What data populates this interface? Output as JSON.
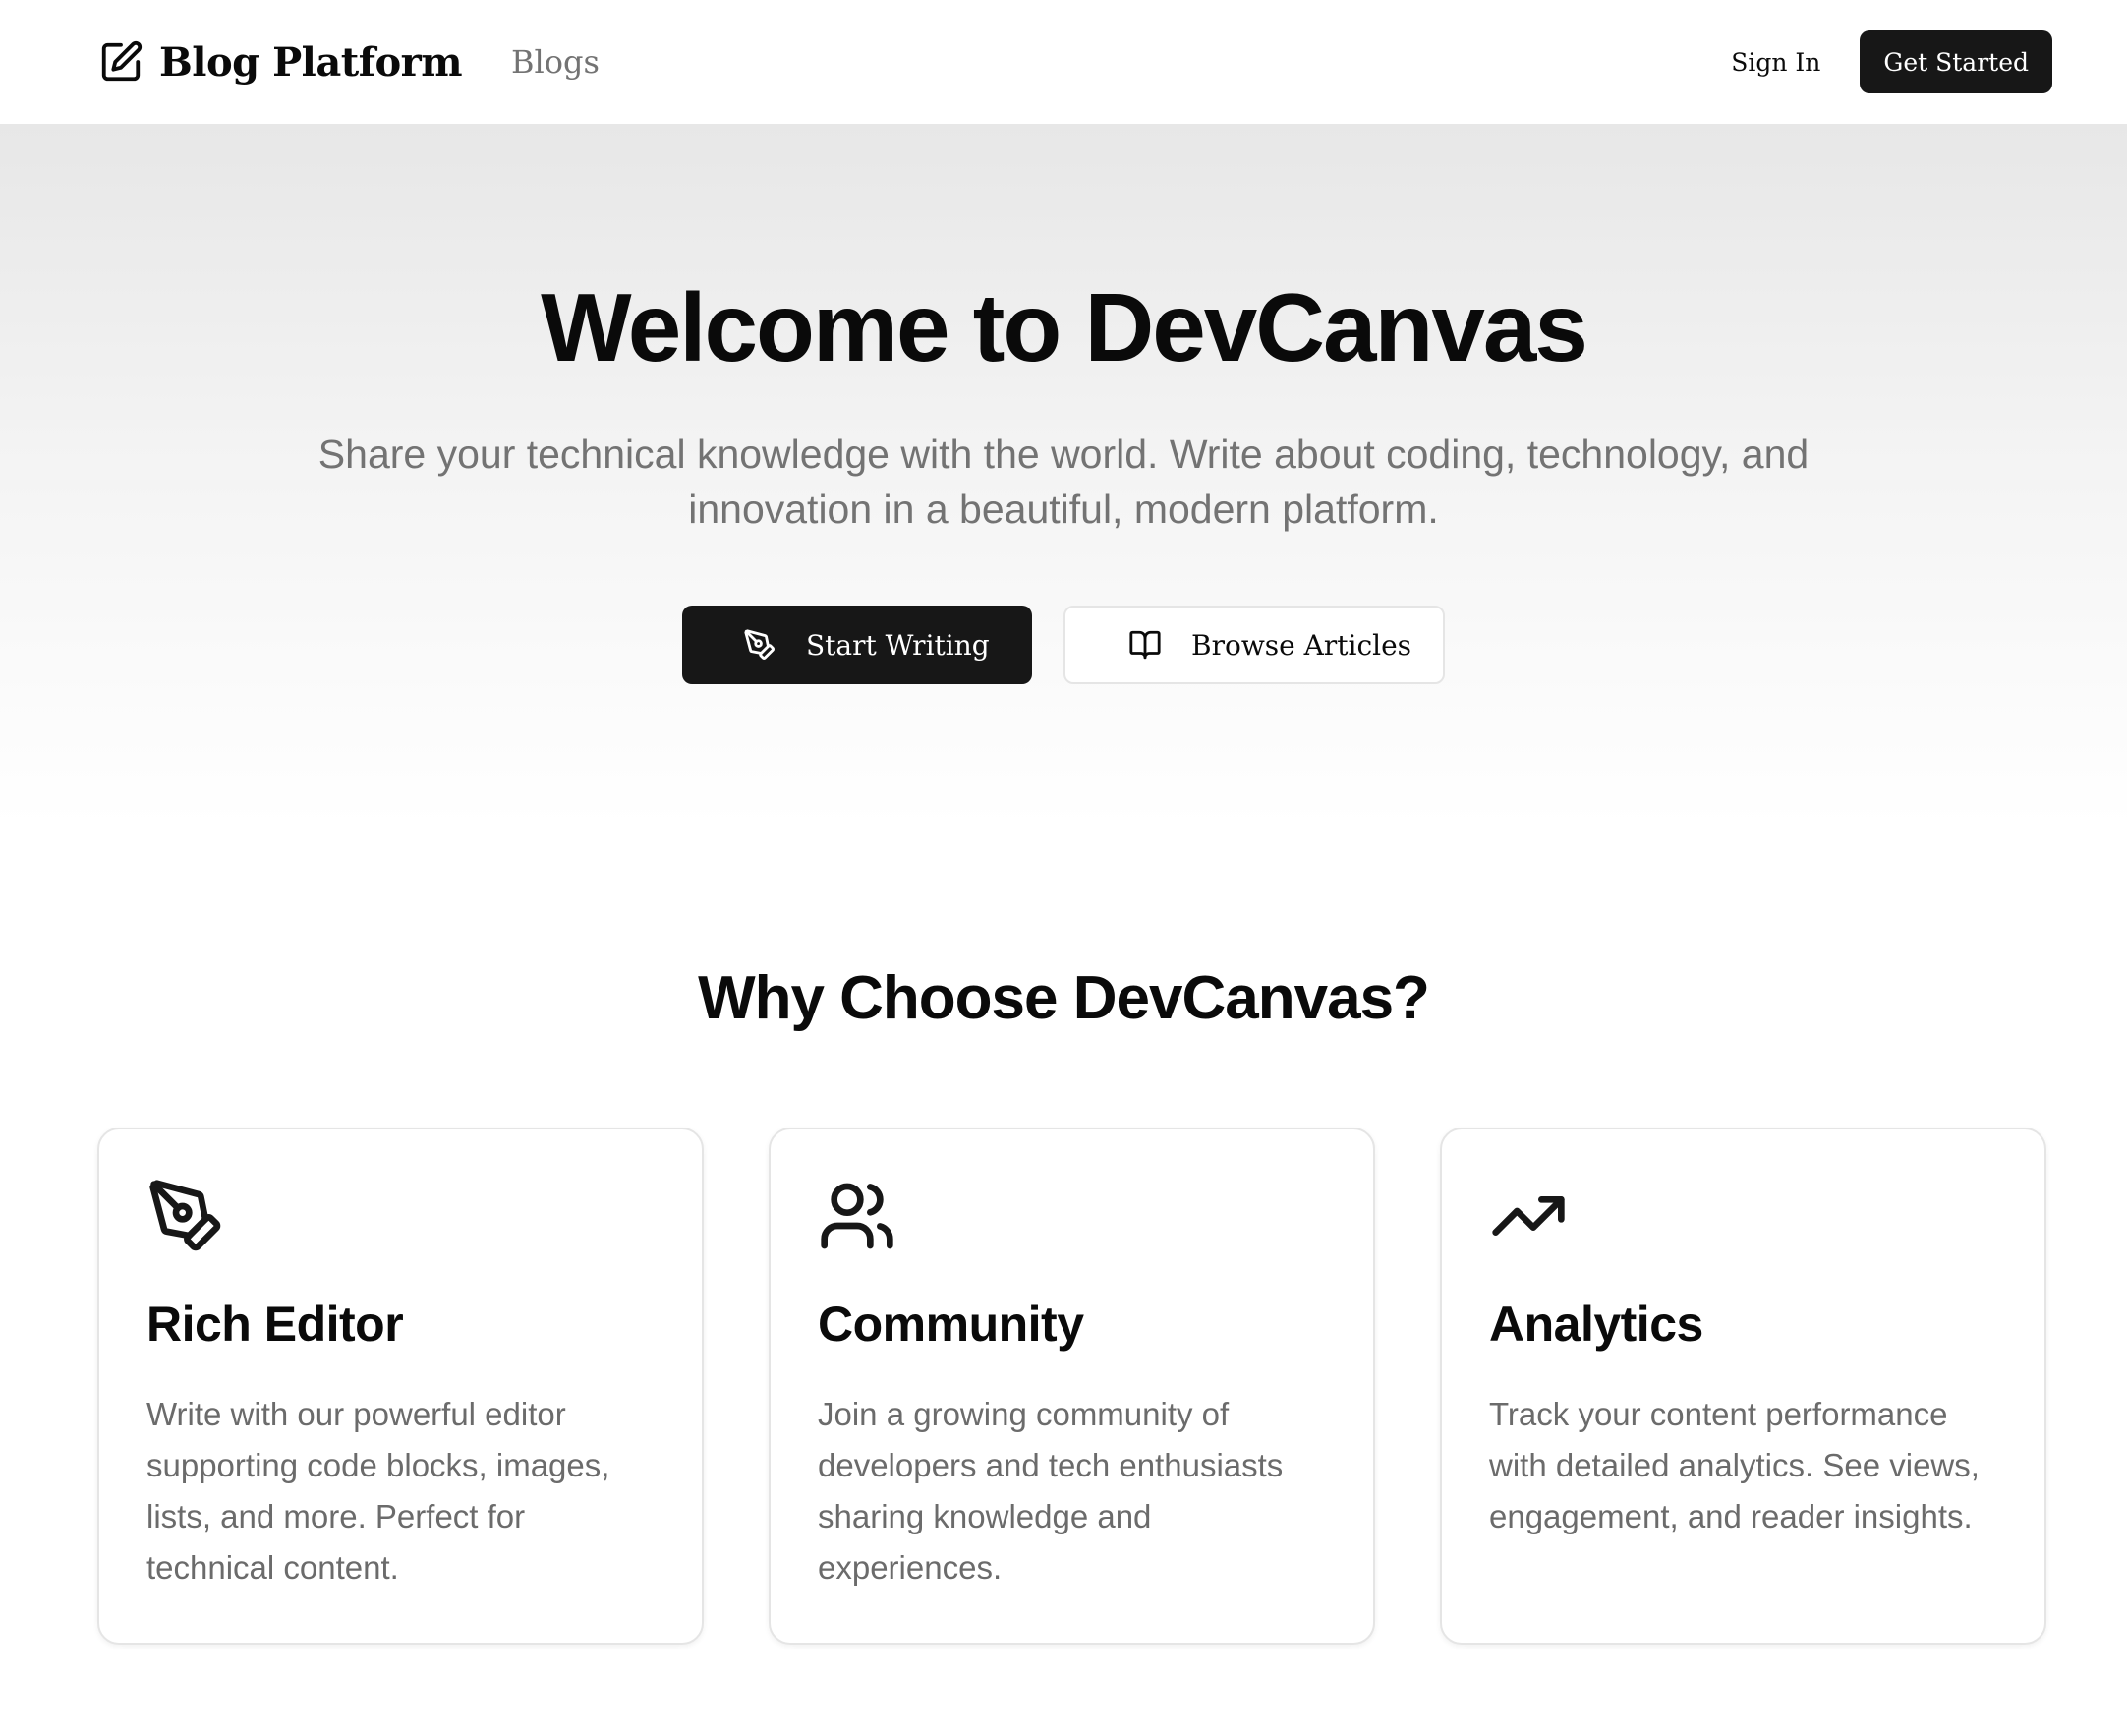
{
  "header": {
    "brand_name": "Blog Platform",
    "brand_icon": "edit-square-icon",
    "nav": {
      "blogs": "Blogs"
    },
    "sign_in": "Sign In",
    "get_started": "Get Started"
  },
  "hero": {
    "title": "Welcome to DevCanvas",
    "subtitle": "Share your technical knowledge with the world. Write about coding, technology, and innovation in a beautiful, modern platform.",
    "primary_button": {
      "label": "Start Writing",
      "icon": "pen-tool-icon"
    },
    "secondary_button": {
      "label": "Browse Articles",
      "icon": "book-open-icon"
    }
  },
  "features": {
    "title": "Why Choose DevCanvas?",
    "cards": [
      {
        "icon": "pen-tool-icon",
        "title": "Rich Editor",
        "text": "Write with our powerful editor supporting code blocks, images, lists, and more. Perfect for technical content."
      },
      {
        "icon": "users-icon",
        "title": "Community",
        "text": "Join a growing community of developers and tech enthusiasts sharing knowledge and experiences."
      },
      {
        "icon": "trending-up-icon",
        "title": "Analytics",
        "text": "Track your content performance with detailed analytics. See views, engagement, and reader insights."
      }
    ]
  },
  "colors": {
    "primary_dark": "#171717",
    "text_main": "#0a0a0a",
    "text_muted": "#737373",
    "border": "#e5e5e5"
  }
}
